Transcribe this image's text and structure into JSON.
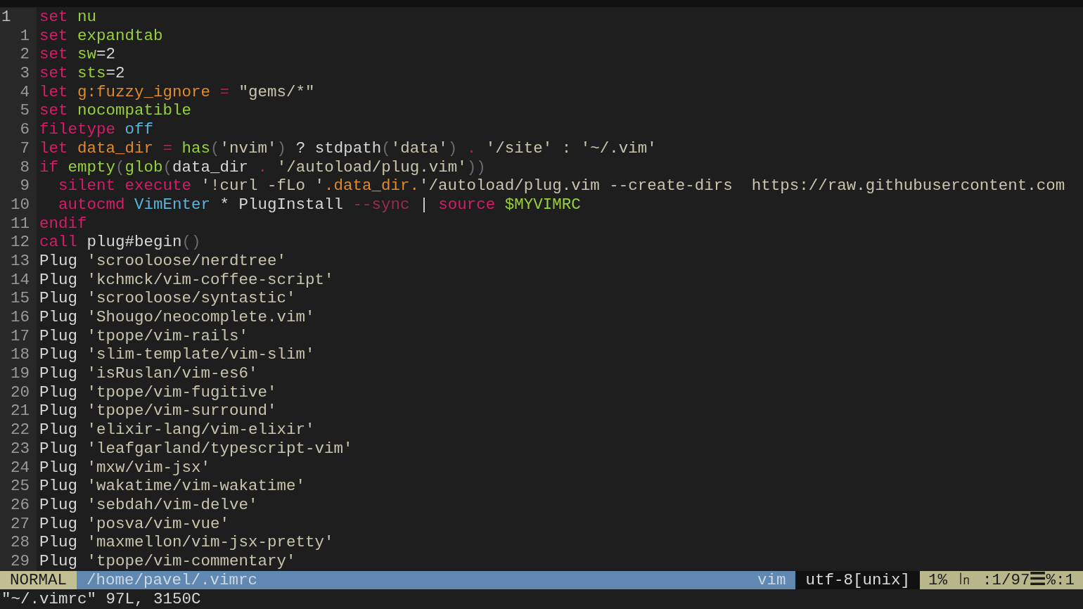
{
  "editor": {
    "lines": [
      {
        "number": "1",
        "current": true,
        "tokens": [
          {
            "kind": "keyword",
            "text": "set"
          },
          {
            "kind": "option",
            "text": " nu"
          }
        ]
      },
      {
        "number": "1",
        "current": false,
        "tokens": [
          {
            "kind": "keyword",
            "text": "set"
          },
          {
            "kind": "option",
            "text": " expandtab"
          }
        ]
      },
      {
        "number": "2",
        "current": false,
        "tokens": [
          {
            "kind": "keyword",
            "text": "set"
          },
          {
            "kind": "option",
            "text": " sw"
          },
          {
            "kind": "text",
            "text": "=2"
          }
        ]
      },
      {
        "number": "3",
        "current": false,
        "tokens": [
          {
            "kind": "keyword",
            "text": "set"
          },
          {
            "kind": "option",
            "text": " sts"
          },
          {
            "kind": "text",
            "text": "=2"
          }
        ]
      },
      {
        "number": "4",
        "current": false,
        "tokens": [
          {
            "kind": "keyword",
            "text": "let"
          },
          {
            "kind": "variable",
            "text": " g:fuzzy_ignore"
          },
          {
            "kind": "operator",
            "text": " ="
          },
          {
            "kind": "string",
            "text": " \"gems/*\""
          }
        ]
      },
      {
        "number": "5",
        "current": false,
        "tokens": [
          {
            "kind": "keyword",
            "text": "set"
          },
          {
            "kind": "option",
            "text": " nocompatible"
          }
        ]
      },
      {
        "number": "6",
        "current": false,
        "tokens": [
          {
            "kind": "keyword",
            "text": "filetype"
          },
          {
            "kind": "constant",
            "text": " off"
          }
        ]
      },
      {
        "number": "7",
        "current": false,
        "tokens": [
          {
            "kind": "keyword",
            "text": "let"
          },
          {
            "kind": "variable",
            "text": " data_dir"
          },
          {
            "kind": "operator",
            "text": " ="
          },
          {
            "kind": "option",
            "text": " has"
          },
          {
            "kind": "paren",
            "text": "("
          },
          {
            "kind": "string",
            "text": "'nvim'"
          },
          {
            "kind": "paren",
            "text": ")"
          },
          {
            "kind": "text",
            "text": " ? stdpath"
          },
          {
            "kind": "paren",
            "text": "("
          },
          {
            "kind": "string",
            "text": "'data'"
          },
          {
            "kind": "paren",
            "text": ")"
          },
          {
            "kind": "operator",
            "text": " ."
          },
          {
            "kind": "string",
            "text": " '/site' : '~/.vim'"
          }
        ]
      },
      {
        "number": "8",
        "current": false,
        "tokens": [
          {
            "kind": "keyword",
            "text": "if"
          },
          {
            "kind": "option",
            "text": " empty"
          },
          {
            "kind": "paren",
            "text": "("
          },
          {
            "kind": "option",
            "text": "glob"
          },
          {
            "kind": "paren",
            "text": "("
          },
          {
            "kind": "text",
            "text": "data_dir "
          },
          {
            "kind": "operator",
            "text": "."
          },
          {
            "kind": "string",
            "text": " '/autoload/plug.vim'"
          },
          {
            "kind": "paren",
            "text": "))"
          }
        ]
      },
      {
        "number": "9",
        "current": false,
        "tokens": [
          {
            "kind": "keyword",
            "text": "  silent execute"
          },
          {
            "kind": "string",
            "text": " '!curl -fLo '"
          },
          {
            "kind": "variable",
            "text": ".data_dir."
          },
          {
            "kind": "string",
            "text": "'/autoload/plug.vim --create-dirs  https://raw.githubusercontent.com"
          }
        ]
      },
      {
        "number": "10",
        "current": false,
        "tokens": [
          {
            "kind": "keyword",
            "text": "  autocmd"
          },
          {
            "kind": "constant",
            "text": " VimEnter"
          },
          {
            "kind": "text",
            "text": " * PlugInstall "
          },
          {
            "kind": "operator",
            "text": "--sync"
          },
          {
            "kind": "text",
            "text": " | "
          },
          {
            "kind": "keyword",
            "text": "source"
          },
          {
            "kind": "option",
            "text": " $MYVIMRC"
          }
        ]
      },
      {
        "number": "11",
        "current": false,
        "tokens": [
          {
            "kind": "keyword",
            "text": "endif"
          }
        ]
      },
      {
        "number": "12",
        "current": false,
        "tokens": [
          {
            "kind": "keyword",
            "text": "call"
          },
          {
            "kind": "text",
            "text": " plug#begin"
          },
          {
            "kind": "paren",
            "text": "()"
          }
        ]
      },
      {
        "number": "13",
        "current": false,
        "tokens": [
          {
            "kind": "text",
            "text": "Plug"
          },
          {
            "kind": "string",
            "text": " 'scrooloose/nerdtree'"
          }
        ]
      },
      {
        "number": "14",
        "current": false,
        "tokens": [
          {
            "kind": "text",
            "text": "Plug"
          },
          {
            "kind": "string",
            "text": " 'kchmck/vim-coffee-script'"
          }
        ]
      },
      {
        "number": "15",
        "current": false,
        "tokens": [
          {
            "kind": "text",
            "text": "Plug"
          },
          {
            "kind": "string",
            "text": " 'scrooloose/syntastic'"
          }
        ]
      },
      {
        "number": "16",
        "current": false,
        "tokens": [
          {
            "kind": "text",
            "text": "Plug"
          },
          {
            "kind": "string",
            "text": " 'Shougo/neocomplete.vim'"
          }
        ]
      },
      {
        "number": "17",
        "current": false,
        "tokens": [
          {
            "kind": "text",
            "text": "Plug"
          },
          {
            "kind": "string",
            "text": " 'tpope/vim-rails'"
          }
        ]
      },
      {
        "number": "18",
        "current": false,
        "tokens": [
          {
            "kind": "text",
            "text": "Plug"
          },
          {
            "kind": "string",
            "text": " 'slim-template/vim-slim'"
          }
        ]
      },
      {
        "number": "19",
        "current": false,
        "tokens": [
          {
            "kind": "text",
            "text": "Plug"
          },
          {
            "kind": "string",
            "text": " 'isRuslan/vim-es6'"
          }
        ]
      },
      {
        "number": "20",
        "current": false,
        "tokens": [
          {
            "kind": "text",
            "text": "Plug"
          },
          {
            "kind": "string",
            "text": " 'tpope/vim-fugitive'"
          }
        ]
      },
      {
        "number": "21",
        "current": false,
        "tokens": [
          {
            "kind": "text",
            "text": "Plug"
          },
          {
            "kind": "string",
            "text": " 'tpope/vim-surround'"
          }
        ]
      },
      {
        "number": "22",
        "current": false,
        "tokens": [
          {
            "kind": "text",
            "text": "Plug"
          },
          {
            "kind": "string",
            "text": " 'elixir-lang/vim-elixir'"
          }
        ]
      },
      {
        "number": "23",
        "current": false,
        "tokens": [
          {
            "kind": "text",
            "text": "Plug"
          },
          {
            "kind": "string",
            "text": " 'leafgarland/typescript-vim'"
          }
        ]
      },
      {
        "number": "24",
        "current": false,
        "tokens": [
          {
            "kind": "text",
            "text": "Plug"
          },
          {
            "kind": "string",
            "text": " 'mxw/vim-jsx'"
          }
        ]
      },
      {
        "number": "25",
        "current": false,
        "tokens": [
          {
            "kind": "text",
            "text": "Plug"
          },
          {
            "kind": "string",
            "text": " 'wakatime/vim-wakatime'"
          }
        ]
      },
      {
        "number": "26",
        "current": false,
        "tokens": [
          {
            "kind": "text",
            "text": "Plug"
          },
          {
            "kind": "string",
            "text": " 'sebdah/vim-delve'"
          }
        ]
      },
      {
        "number": "27",
        "current": false,
        "tokens": [
          {
            "kind": "text",
            "text": "Plug"
          },
          {
            "kind": "string",
            "text": " 'posva/vim-vue'"
          }
        ]
      },
      {
        "number": "28",
        "current": false,
        "tokens": [
          {
            "kind": "text",
            "text": "Plug"
          },
          {
            "kind": "string",
            "text": " 'maxmellon/vim-jsx-pretty'"
          }
        ]
      },
      {
        "number": "29",
        "current": false,
        "tokens": [
          {
            "kind": "text",
            "text": "Plug"
          },
          {
            "kind": "string",
            "text": " 'tpope/vim-commentary'"
          }
        ]
      }
    ]
  },
  "status_bar": {
    "mode": "NORMAL",
    "path": "/home/pavel/.vimrc",
    "filetype": "vim",
    "encoding": "utf-8[unix]",
    "position": "1% ㏑ :1/97☰%:1"
  },
  "command_line": "\"~/.vimrc\" 97L, 3150C"
}
